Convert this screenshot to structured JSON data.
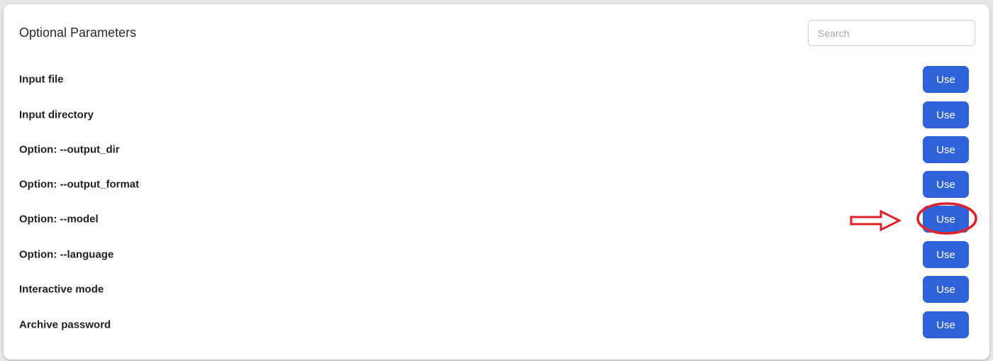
{
  "panel": {
    "title": "Optional Parameters",
    "search": {
      "placeholder": "Search",
      "value": ""
    }
  },
  "parameters": [
    {
      "label": "Input file",
      "button": "Use"
    },
    {
      "label": "Input directory",
      "button": "Use"
    },
    {
      "label": "Option: --output_dir",
      "button": "Use"
    },
    {
      "label": "Option: --output_format",
      "button": "Use"
    },
    {
      "label": "Option: --model",
      "button": "Use",
      "highlighted": true
    },
    {
      "label": "Option: --language",
      "button": "Use"
    },
    {
      "label": "Interactive mode",
      "button": "Use"
    },
    {
      "label": "Archive password",
      "button": "Use"
    }
  ],
  "annotation": {
    "type": "red-arrow-and-circle",
    "target": "Option: --model Use button",
    "color": "#e0202a"
  },
  "colors": {
    "button": "#2f62d9",
    "annotation": "#e0202a"
  }
}
